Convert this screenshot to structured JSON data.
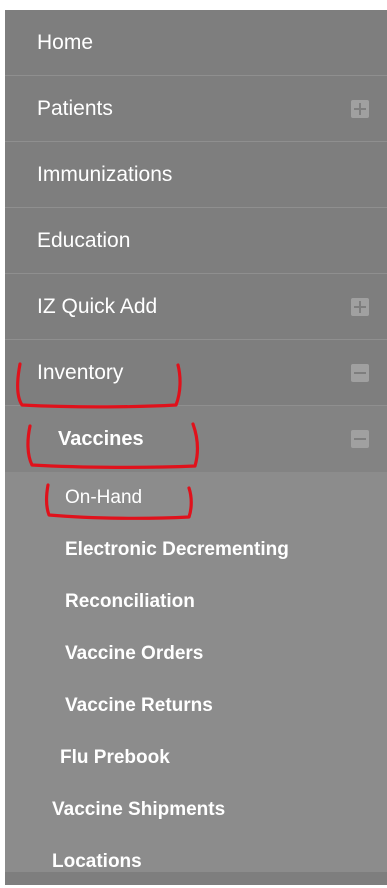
{
  "menu": {
    "items": [
      {
        "label": "Home",
        "expandable": false
      },
      {
        "label": "Patients",
        "expandable": true,
        "state": "collapsed"
      },
      {
        "label": "Immunizations",
        "expandable": false
      },
      {
        "label": "Education",
        "expandable": false
      },
      {
        "label": "IZ Quick Add",
        "expandable": true,
        "state": "collapsed"
      },
      {
        "label": "Inventory",
        "expandable": true,
        "state": "expanded"
      }
    ],
    "inventory_submenu": {
      "vaccines": {
        "label": "Vaccines",
        "state": "expanded",
        "children": [
          {
            "label": "On-Hand"
          },
          {
            "label": "Electronic Decrementing"
          },
          {
            "label": "Reconciliation"
          },
          {
            "label": "Vaccine Orders"
          },
          {
            "label": "Vaccine Returns"
          },
          {
            "label": "Flu Prebook"
          }
        ]
      },
      "other": [
        {
          "label": "Vaccine Shipments"
        },
        {
          "label": "Locations"
        }
      ]
    }
  },
  "colors": {
    "menu_bg": "#7e7e7e",
    "submenu_bg": "#8c8c8c",
    "annotation_red": "#e0111b",
    "text": "#ffffff"
  },
  "icons": {
    "expand": "plus-box-icon",
    "collapse": "minus-box-icon"
  }
}
